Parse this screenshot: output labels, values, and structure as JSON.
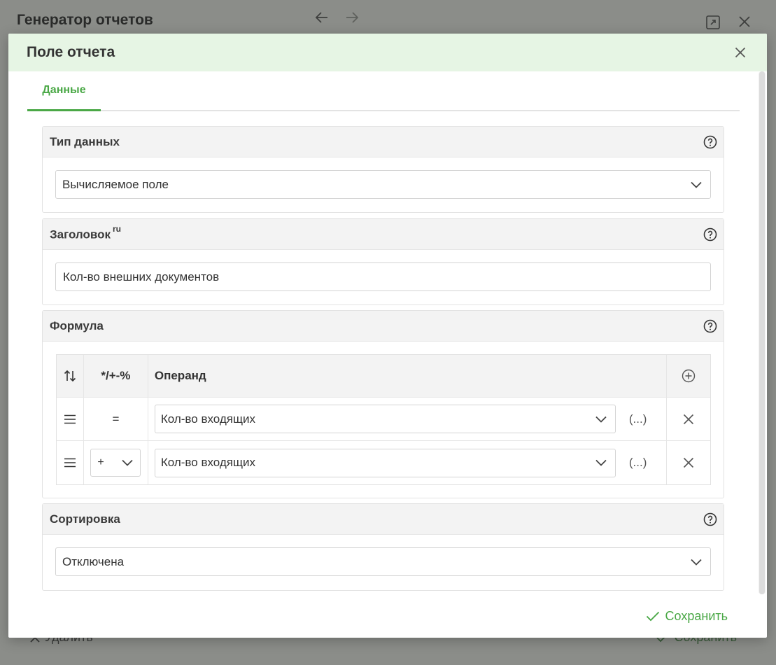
{
  "background": {
    "title": "Генератор отчетов",
    "delete_label": "Удалить",
    "save_label": "Сохранить"
  },
  "modal": {
    "title": "Поле отчета",
    "tabs": [
      {
        "label": "Данные",
        "active": true
      }
    ],
    "data_type": {
      "title": "Тип данных",
      "value": "Вычисляемое поле"
    },
    "caption": {
      "title": "Заголовок",
      "lang": "ru",
      "value": "Кол-во внешних документов"
    },
    "formula": {
      "title": "Формула",
      "columns": {
        "operator": "*/+-%",
        "operand": "Операнд"
      },
      "rows": [
        {
          "operator": "=",
          "operand": "Кол-во входящих",
          "extra": "(...)",
          "operator_editable": false
        },
        {
          "operator": "+",
          "operand": "Кол-во входящих",
          "extra": "(...)",
          "operator_editable": true
        }
      ]
    },
    "sorting": {
      "title": "Сортировка",
      "value": "Отключена"
    },
    "save_label": "Сохранить"
  },
  "colors": {
    "accent": "#4aa846",
    "header_bg": "#e6f5e4",
    "panel_head_bg": "#f3f3f3"
  }
}
